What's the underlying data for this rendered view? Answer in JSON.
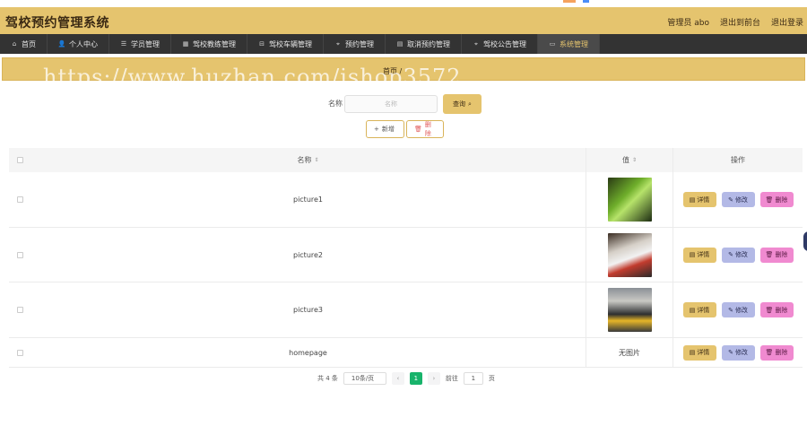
{
  "app": {
    "title": "驾校预约管理系统"
  },
  "header": {
    "user": "管理员 abo",
    "back_front": "退出到前台",
    "logout": "退出登录"
  },
  "nav": [
    {
      "label": "首页",
      "icon": "home-icon",
      "glyph": "⌂"
    },
    {
      "label": "个人中心",
      "icon": "user-icon",
      "glyph": "👤"
    },
    {
      "label": "学员管理",
      "icon": "list-icon",
      "glyph": "☰"
    },
    {
      "label": "驾校教练管理",
      "icon": "grid-icon",
      "glyph": "▦"
    },
    {
      "label": "驾校车辆管理",
      "icon": "car-icon",
      "glyph": "⊟"
    },
    {
      "label": "预约管理",
      "icon": "pin-icon",
      "glyph": "⌖"
    },
    {
      "label": "取消预约管理",
      "icon": "table-icon",
      "glyph": "▤"
    },
    {
      "label": "驾校公告管理",
      "icon": "pin-icon",
      "glyph": "⌖"
    },
    {
      "label": "系统管理",
      "icon": "menu-icon",
      "glyph": "▭"
    }
  ],
  "breadcrumb": {
    "home": "首页",
    "sep": "/"
  },
  "watermark": "https://www.huzhan.com/ishop3572",
  "search": {
    "label": "名称",
    "placeholder": "名称",
    "button": "查询"
  },
  "actions": {
    "add": "新增",
    "delete": "删除"
  },
  "table": {
    "headers": {
      "name": "名称",
      "value": "值",
      "ops": "操作"
    },
    "rows": [
      {
        "name": "picture1",
        "value_type": "image",
        "value": ""
      },
      {
        "name": "picture2",
        "value_type": "image",
        "value": ""
      },
      {
        "name": "picture3",
        "value_type": "image",
        "value": ""
      },
      {
        "name": "homepage",
        "value_type": "text",
        "value": "无图片"
      }
    ],
    "ops": {
      "detail": "详情",
      "edit": "修改",
      "delete": "删除"
    }
  },
  "pagination": {
    "total": "共 4 条",
    "page_size": "10条/页",
    "current": "1",
    "goto_prefix": "前往",
    "goto_value": "1",
    "goto_suffix": "页"
  },
  "colors": {
    "accent": "#e5c46e",
    "nav_bg": "#333333",
    "edit": "#b3b9e6",
    "delete": "#f08ad0",
    "page_active": "#18b36b"
  }
}
